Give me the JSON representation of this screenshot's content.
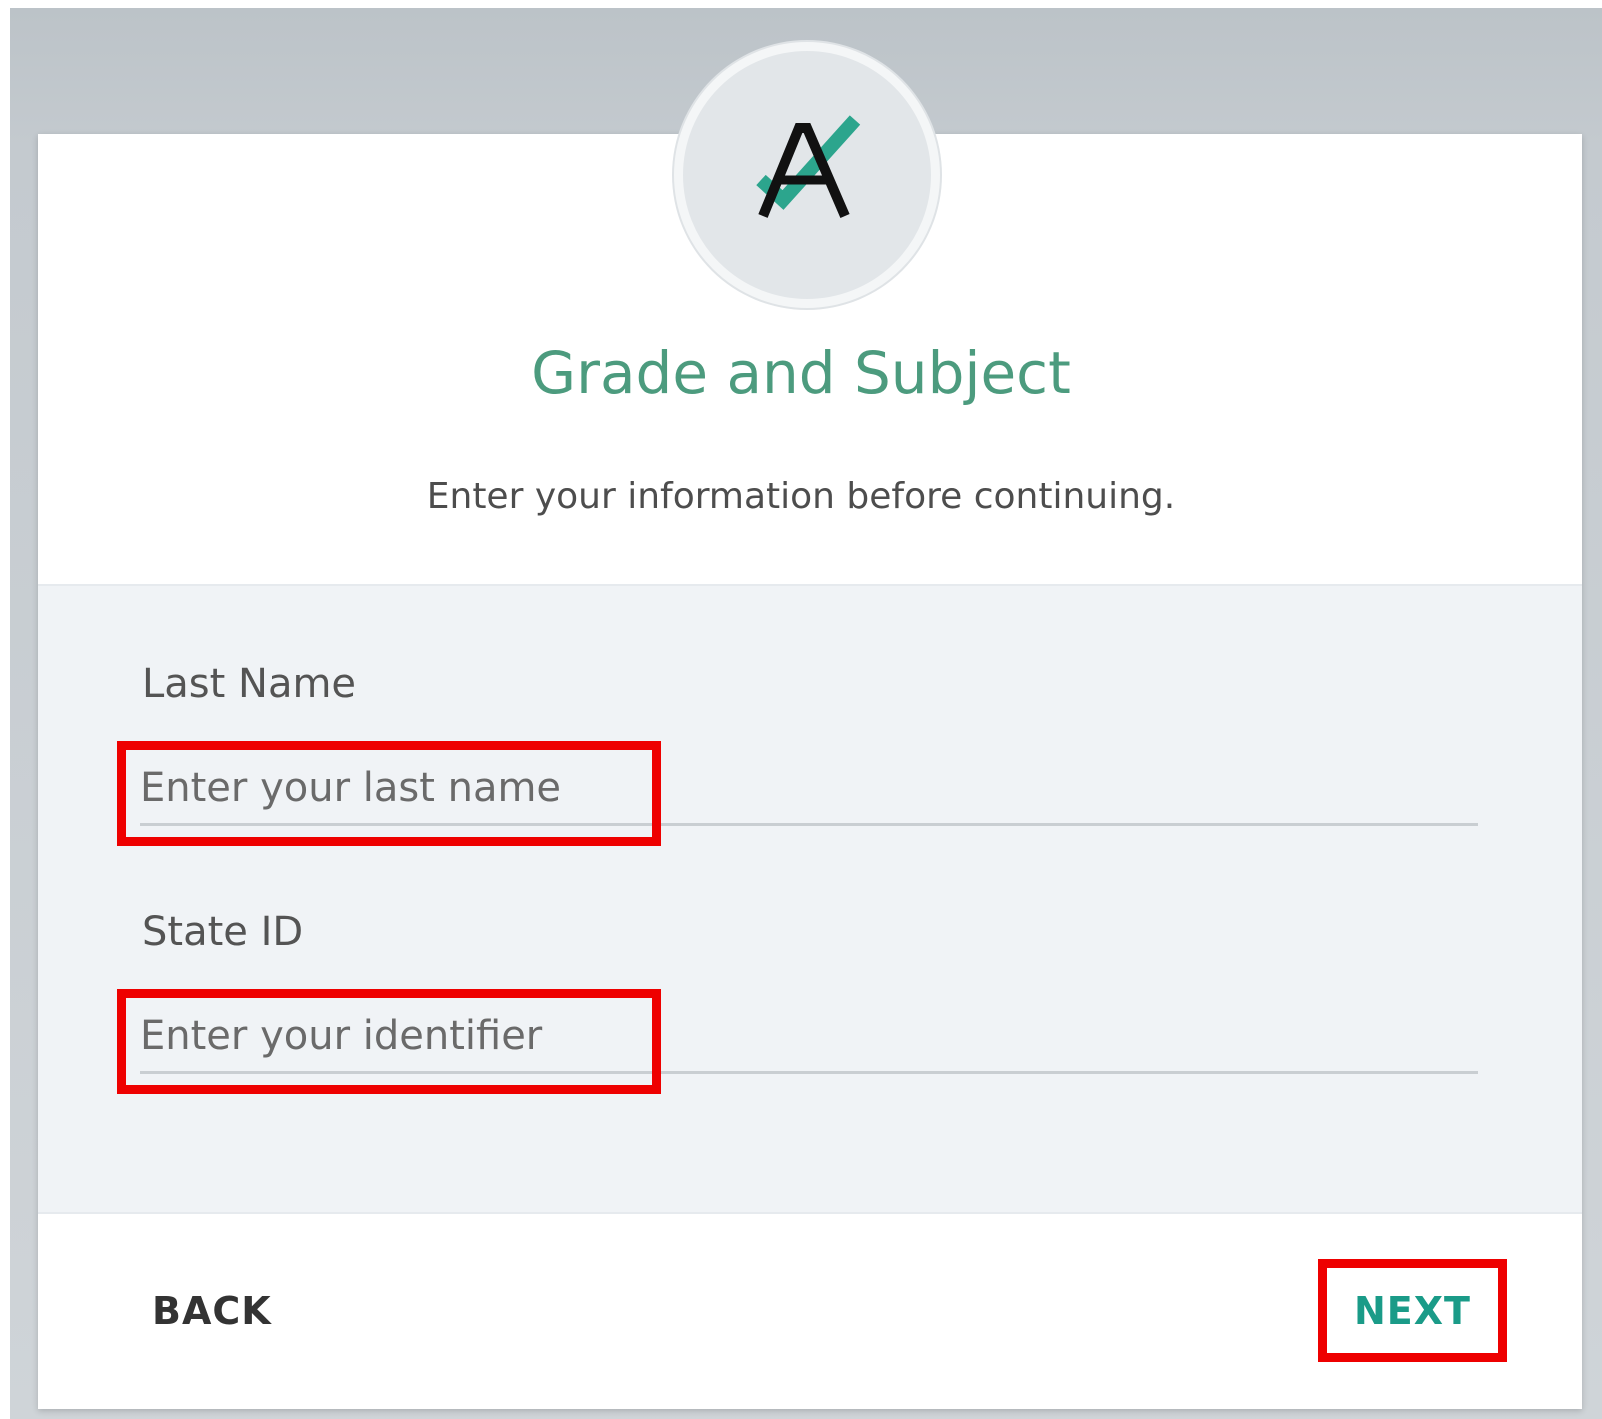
{
  "page": {
    "title": "Grade and Subject",
    "subtitle": "Enter your information before continuing."
  },
  "logo": {
    "icon": "a-checkmark-logo-icon",
    "accent_color": "#2ca58d"
  },
  "form": {
    "last_name": {
      "label": "Last Name",
      "placeholder": "Enter your last name",
      "value": ""
    },
    "state_id": {
      "label": "State ID",
      "placeholder": "Enter your identifier",
      "value": ""
    }
  },
  "footer": {
    "back_label": "BACK",
    "next_label": "NEXT"
  },
  "colors": {
    "title": "#4c9b7e",
    "next_button": "#1a9b88",
    "highlight": "#ee0000"
  }
}
